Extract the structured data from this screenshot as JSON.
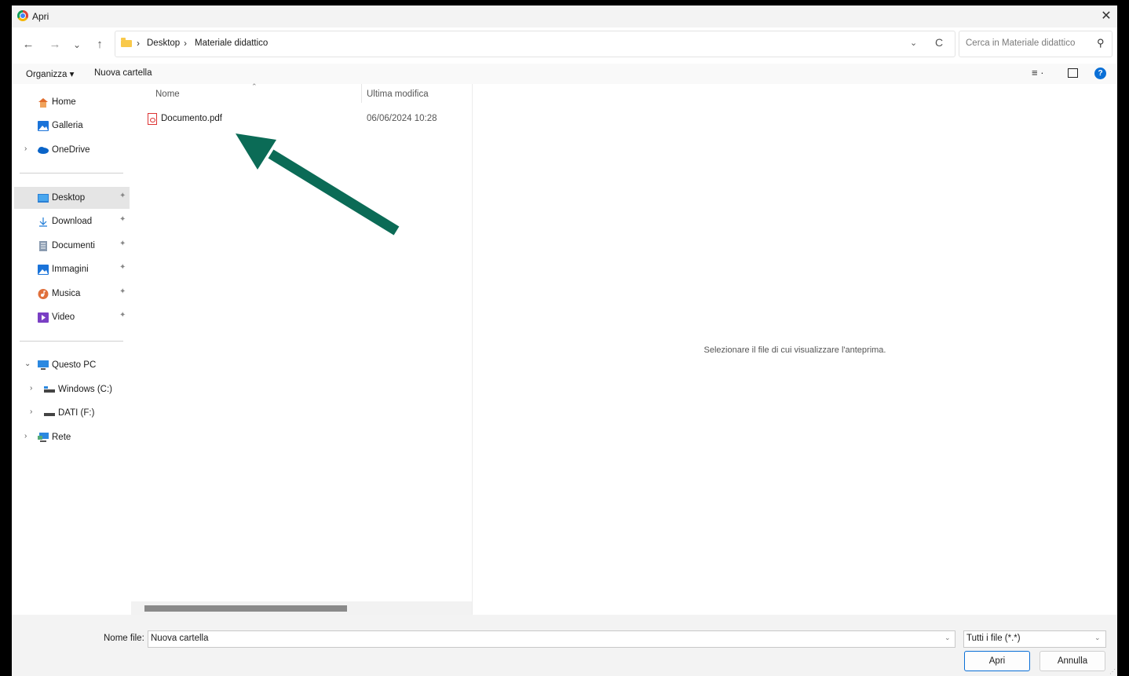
{
  "window": {
    "title": "Apri",
    "close_glyph": "✕"
  },
  "nav": {
    "back": "←",
    "forward": "→",
    "recent": "⌄",
    "up": "↑",
    "breadcrumb": [
      "Desktop",
      "Materiale didattico"
    ],
    "crumb_sep": "›",
    "dropdown_glyph": "⌄",
    "refresh": "C",
    "search_placeholder": "Cerca in Materiale didattico",
    "search_glyph": "⚲"
  },
  "toolbar": {
    "organize": "Organizza ▾",
    "new_folder": "Nuova cartella",
    "view_glyph": "≡ ·",
    "help": "?"
  },
  "sidebar": {
    "quick": [
      {
        "label": "Home",
        "icon": "home-icon"
      },
      {
        "label": "Galleria",
        "icon": "gallery-icon"
      },
      {
        "label": "OneDrive",
        "icon": "onedrive-icon",
        "chevron": "›"
      }
    ],
    "pinned": [
      {
        "label": "Desktop",
        "icon": "desktop-icon",
        "pin": "📌",
        "selected": true
      },
      {
        "label": "Download",
        "icon": "download-icon",
        "pin": "📌"
      },
      {
        "label": "Documenti",
        "icon": "documents-icon",
        "pin": "📌"
      },
      {
        "label": "Immagini",
        "icon": "pictures-icon",
        "pin": "📌"
      },
      {
        "label": "Musica",
        "icon": "music-icon",
        "pin": "📌"
      },
      {
        "label": "Video",
        "icon": "video-icon",
        "pin": "📌"
      }
    ],
    "drives": [
      {
        "label": "Questo PC",
        "icon": "pc-icon",
        "chevron": "⌄"
      },
      {
        "label": "Windows (C:)",
        "icon": "drive-icon",
        "chevron": "›"
      },
      {
        "label": "DATI (F:)",
        "icon": "drive-icon",
        "chevron": "›"
      },
      {
        "label": "Rete",
        "icon": "network-icon",
        "chevron": "›"
      }
    ]
  },
  "files": {
    "columns": {
      "name": "Nome",
      "modified": "Ultima modifica"
    },
    "sort_glyph": "⌃",
    "rows": [
      {
        "name": "Documento.pdf",
        "modified": "06/06/2024 10:28"
      }
    ]
  },
  "preview": {
    "message": "Selezionare il file di cui visualizzare l'anteprima."
  },
  "footer": {
    "filename_label": "Nome file:",
    "filename_value": "Nuova cartella",
    "filter_value": "Tutti i file (*.*)",
    "dropdown_glyph": "⌄",
    "open": "Apri",
    "cancel": "Annulla",
    "grip": "⋰"
  },
  "colors": {
    "arrow": "#0b6b56",
    "accent": "#0a6fd6"
  }
}
